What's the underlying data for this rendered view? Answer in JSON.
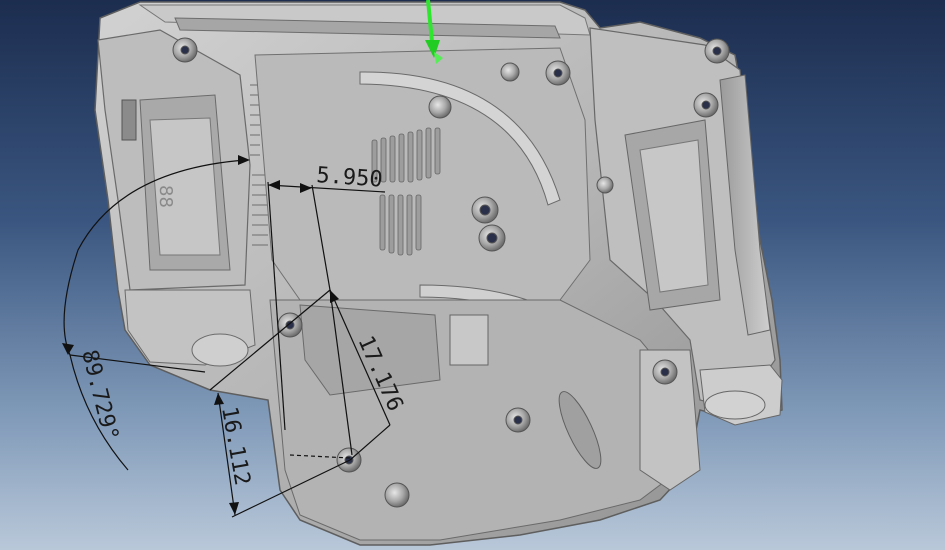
{
  "viewport": {
    "background_top": "#1c2d4f",
    "background_bottom": "#b9c8d9",
    "part_color": "#b4b4b4",
    "axis_color": "#2ee62e"
  },
  "dimensions": {
    "horizontal": "5.950",
    "vertical": "16.112",
    "diagonal": "17.176",
    "angle": "89.729°"
  }
}
